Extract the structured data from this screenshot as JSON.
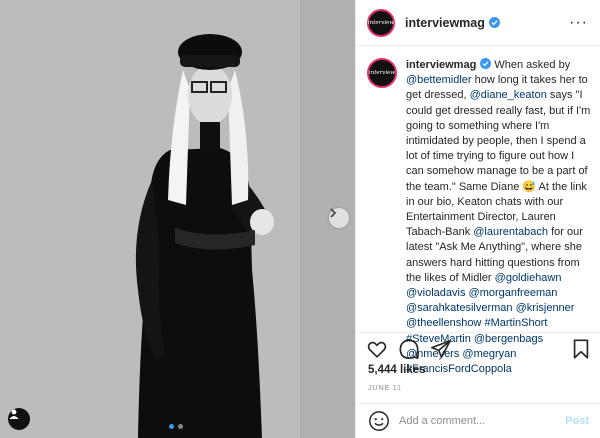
{
  "post": {
    "username": "interviewmag",
    "avatar_text": "interview",
    "caption": {
      "part1": "When asked by ",
      "m1": "@bettemidler",
      "part2": " how long it takes her to get dressed, ",
      "m2": "@diane_keaton",
      "part3": " says \"I could get dressed really fast, but if I'm going to something where I'm intimidated by people, then I spend a lot of time trying to figure out how I can somehow manage to be a part of the team.\" Same Diane 😅 At the link in our bio, Keaton chats with our Entertainment Director, Lauren Tabach-Bank ",
      "m3": "@laurentabach",
      "part4": " for our latest \"Ask Me Anything\", where she answers hard hitting questions from the likes of Midler ",
      "m4": "@goldiehawn",
      "m5": "@violadavis",
      "m6": "@morganfreeman",
      "m7": "@sarahkatesilverman",
      "m8": "@krisjenner",
      "m9": "@theellenshow",
      "m10": "#MartinShort",
      "m11": "#SteveMartin",
      "m12": "@bergenbags",
      "m13": "@nmeyers",
      "m14": "@megryan",
      "m15": "#FrancisFordCoppola"
    },
    "likes": "5,444 likes",
    "date": "JUNE 11",
    "comment_placeholder": "Add a comment...",
    "post_label": "Post",
    "carousel": {
      "count": 2,
      "active": 0
    }
  },
  "icons": {
    "verified": "verified-badge-icon",
    "more": "more-options-icon",
    "like": "heart-icon",
    "comment": "comment-bubble-icon",
    "share": "paper-plane-icon",
    "save": "bookmark-icon",
    "emoji": "smiley-icon",
    "next": "chevron-right-icon",
    "user_tag": "user-tag-icon"
  },
  "colors": {
    "mention": "#00376b",
    "verified": "#3897f0",
    "post_button": "#b2dffc",
    "ring": "#e1306c"
  }
}
